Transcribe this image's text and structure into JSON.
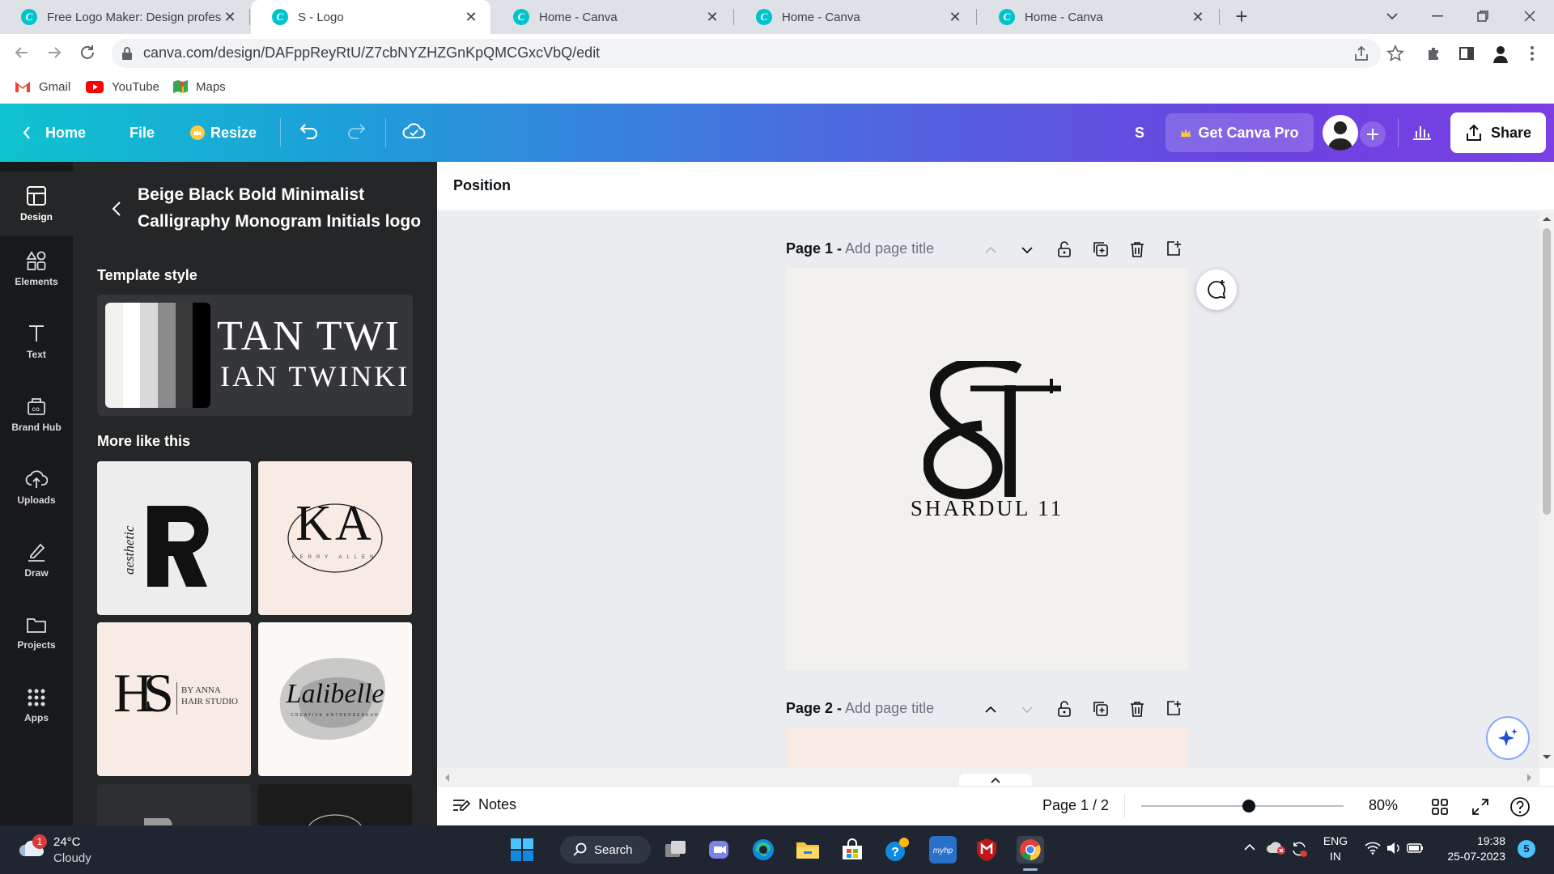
{
  "browser": {
    "tabs": [
      {
        "title": "Free Logo Maker: Design profess",
        "active": false
      },
      {
        "title": "S - Logo",
        "active": true
      },
      {
        "title": "Home - Canva",
        "active": false
      },
      {
        "title": "Home - Canva",
        "active": false
      },
      {
        "title": "Home - Canva",
        "active": false
      }
    ],
    "url": "canva.com/design/DAFppReyRtU/Z7cbNYZHZGnKpQMCGxcVbQ/edit",
    "bookmarks": [
      "Gmail",
      "YouTube",
      "Maps"
    ]
  },
  "header": {
    "home": "Home",
    "file": "File",
    "resize": "Resize",
    "title_initial": "S",
    "get_pro": "Get Canva Pro",
    "share": "Share"
  },
  "rail": {
    "items": [
      "Design",
      "Elements",
      "Text",
      "Brand Hub",
      "Uploads",
      "Draw",
      "Projects",
      "Apps"
    ]
  },
  "panel": {
    "title": "Beige Black Bold Minimalist Calligraphy Monogram Initials logo",
    "template_style": "Template style",
    "style_preview_line1": "TAN TWI",
    "style_preview_line2": "IAN TWINKI",
    "palette": [
      "#f3f1ee",
      "#ffffff",
      "#d9d9d9",
      "#8c8c8c",
      "#3a3a3a",
      "#000000"
    ],
    "more_like_this": "More like this",
    "thumbs": [
      {
        "letter": "R",
        "script": "aesthetic"
      },
      {
        "letters": "KA",
        "sub": "KERRY ALLEN"
      },
      {
        "letters": "HS",
        "sub1": "BY ANNA",
        "sub2": "HAIR STUDIO"
      },
      {
        "script": "Lalibelle",
        "sub": "CREATIVE ENTREPRENEUR"
      }
    ]
  },
  "workspace": {
    "position_label": "Position",
    "page1": {
      "label": "Page 1 -",
      "title_placeholder": "Add page title",
      "monogram": "ST",
      "name": "SHARDUL 11"
    },
    "page2": {
      "label": "Page 2 -",
      "title_placeholder": "Add page title"
    }
  },
  "footer": {
    "notes": "Notes",
    "page_indicator": "Page 1 / 2",
    "zoom": "80%",
    "zoom_level": 0.8
  },
  "taskbar": {
    "weather_temp": "24°C",
    "weather_desc": "Cloudy",
    "weather_badge": "1",
    "search": "Search",
    "lang1": "ENG",
    "lang2": "IN",
    "time": "19:38",
    "date": "25-07-2023",
    "notif": "5"
  }
}
